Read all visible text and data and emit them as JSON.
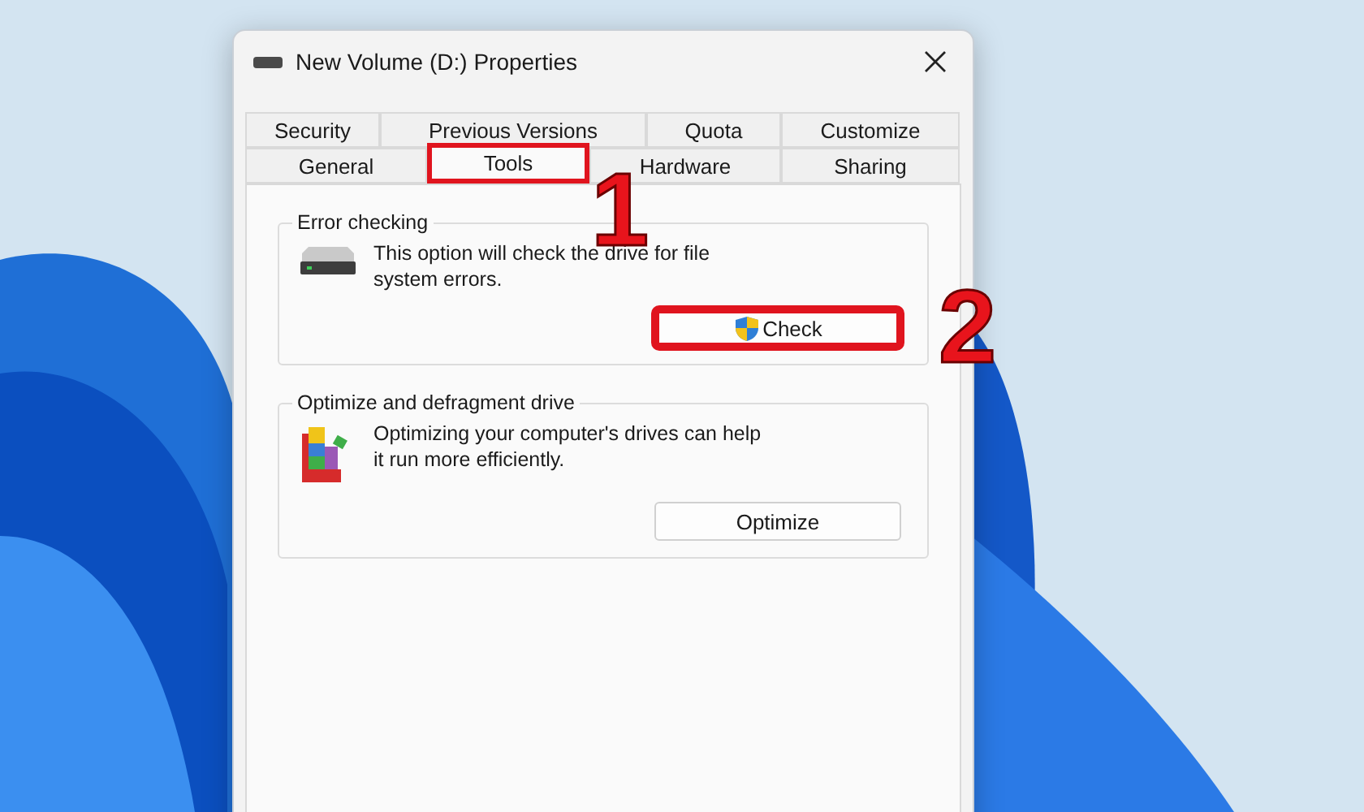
{
  "window": {
    "title": "New Volume (D:) Properties"
  },
  "tabs": {
    "rows": [
      [
        {
          "label": "Security",
          "selected": false,
          "highlighted": false
        },
        {
          "label": "Previous Versions",
          "selected": false,
          "highlighted": false
        },
        {
          "label": "Quota",
          "selected": false,
          "highlighted": false
        },
        {
          "label": "Customize",
          "selected": false,
          "highlighted": false
        }
      ],
      [
        {
          "label": "General",
          "selected": false,
          "highlighted": false
        },
        {
          "label": "Tools",
          "selected": true,
          "highlighted": true
        },
        {
          "label": "Hardware",
          "selected": false,
          "highlighted": false
        },
        {
          "label": "Sharing",
          "selected": false,
          "highlighted": false
        }
      ]
    ]
  },
  "groups": [
    {
      "kind": "check",
      "title": "Error checking",
      "description": "This option will check the drive for file system errors.",
      "button": {
        "label": "Check",
        "shield": true,
        "highlighted": true
      }
    },
    {
      "kind": "optimize",
      "title": "Optimize and defragment drive",
      "description": "Optimizing your computer's drives can help it run more efficiently.",
      "button": {
        "label": "Optimize",
        "shield": false,
        "highlighted": false
      }
    }
  ],
  "callouts": [
    {
      "label": "1"
    },
    {
      "label": "2"
    }
  ]
}
